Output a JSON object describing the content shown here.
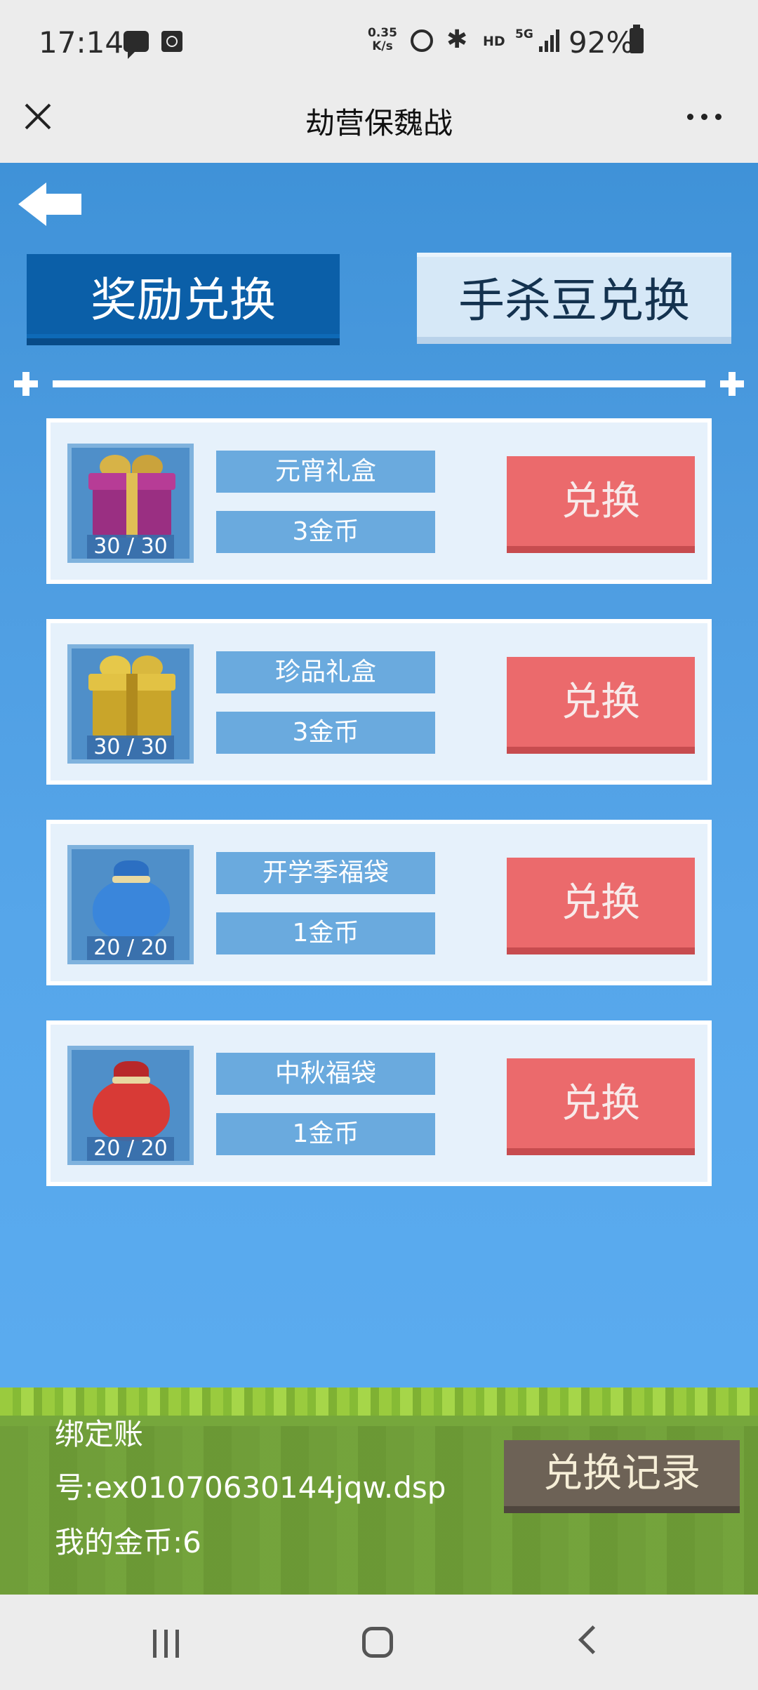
{
  "status_bar": {
    "time": "17:14",
    "speed_value": "0.35",
    "speed_unit": "K/s",
    "hd": "HD",
    "network": "5G",
    "battery": "92%"
  },
  "app": {
    "title": "劫营保魏战"
  },
  "tabs": {
    "active": "奖励兑换",
    "inactive": "手杀豆兑换"
  },
  "items": [
    {
      "name": "元宵礼盒",
      "price": "3金币",
      "count": "30 / 30",
      "button": "兑换",
      "icon": "purple-gift-box-icon"
    },
    {
      "name": "珍品礼盒",
      "price": "3金币",
      "count": "30 / 30",
      "button": "兑换",
      "icon": "gold-gift-box-icon"
    },
    {
      "name": "开学季福袋",
      "price": "1金币",
      "count": "20 / 20",
      "button": "兑换",
      "icon": "blue-lucky-bag-icon"
    },
    {
      "name": "中秋福袋",
      "price": "1金币",
      "count": "20 / 20",
      "button": "兑换",
      "icon": "red-lucky-bag-icon"
    }
  ],
  "footer": {
    "bind_line1": "绑定账",
    "bind_line2": "号:ex01070630144jqw.dsp",
    "coins": "我的金币:6",
    "records_button": "兑换记录"
  },
  "colors": {
    "tab_active": "#0b5fa8",
    "exchange_button": "#eb6a6c",
    "records_button": "#6d6256",
    "grass": "#76a73c"
  }
}
